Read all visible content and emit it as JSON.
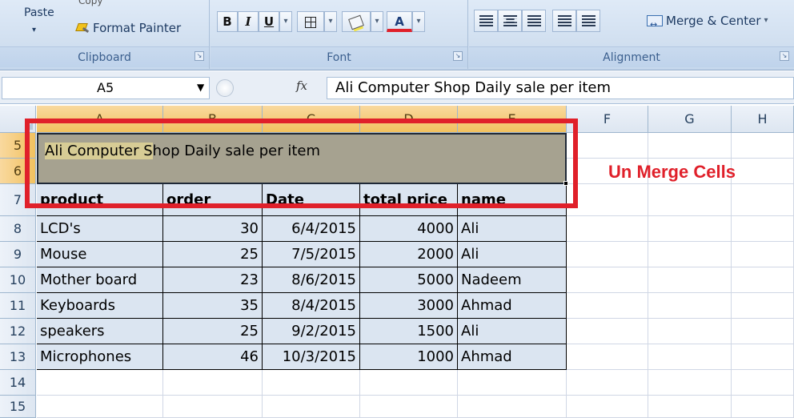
{
  "ribbon": {
    "clipboard": {
      "paste_label": "Paste",
      "paste_arrow": "▾",
      "copy_label": "Copy",
      "format_painter_label": "Format Painter",
      "group_label": "Clipboard"
    },
    "font": {
      "bold": "B",
      "italic": "I",
      "underline": "U",
      "dropdown": "▾",
      "group_label": "Font",
      "font_color": "A",
      "font_color_hex": "#e0202a"
    },
    "alignment": {
      "merge_center_label": "Merge & Center",
      "merge_dropdown": "▾",
      "group_label": "Alignment"
    },
    "launcher_glyph": "↘"
  },
  "formula_bar": {
    "name_box": "A5",
    "name_dropdown": "▼",
    "fx": "fx",
    "content": "Ali Computer Shop Daily sale per item"
  },
  "grid": {
    "columns": [
      "A",
      "B",
      "C",
      "D",
      "E",
      "F",
      "G",
      "H"
    ],
    "rows": [
      "5",
      "6",
      "7",
      "8",
      "9",
      "10",
      "11",
      "12",
      "13",
      "14",
      "15"
    ],
    "merged_title": "Ali Computer Shop Daily sale per item",
    "merged_title_highlight": "Ali Computer S",
    "merged_title_rest": "hop Daily sale per item",
    "headers": [
      "product",
      "order",
      "Date",
      "total price",
      "name"
    ],
    "data_rows": [
      [
        "LCD's",
        "30",
        "6/4/2015",
        "4000",
        "Ali"
      ],
      [
        "Mouse",
        "25",
        "7/5/2015",
        "2000",
        "Ali"
      ],
      [
        "Mother board",
        "23",
        "8/6/2015",
        "5000",
        "Nadeem"
      ],
      [
        "Keyboards",
        "35",
        "8/4/2015",
        "3000",
        "Ahmad"
      ],
      [
        "speakers",
        "25",
        "9/2/2015",
        "1500",
        "Ali"
      ],
      [
        "Microphones",
        "46",
        "10/3/2015",
        "1000",
        "Ahmad"
      ]
    ]
  },
  "annotation": {
    "label": "Un Merge Cells",
    "color": "#e0202a"
  },
  "colors": {
    "table_fill": "#dbe5f1",
    "merged_fill": "#a6a290",
    "selected_header": "#f1c15f"
  }
}
